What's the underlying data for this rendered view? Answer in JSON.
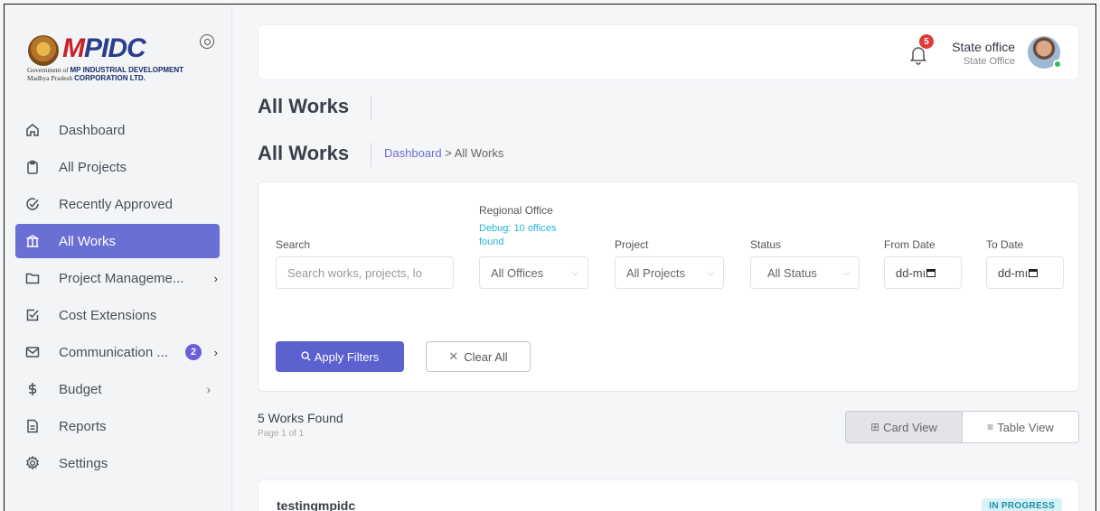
{
  "logo": {
    "brand_prefix": "M",
    "brand_text": "PIDC",
    "line1_left": "Government of",
    "line1_right": "MP INDUSTRIAL DEVELOPMENT",
    "line2_left": "Madhya Pradesh",
    "line2_right": "CORPORATION LTD."
  },
  "sidebar": {
    "items": [
      {
        "label": "Dashboard",
        "icon": "home-icon"
      },
      {
        "label": "All Projects",
        "icon": "clipboard-icon"
      },
      {
        "label": "Recently Approved",
        "icon": "check-circle-icon"
      },
      {
        "label": "All Works",
        "icon": "building-icon",
        "active": true
      },
      {
        "label": "Project Manageme...",
        "icon": "folder-icon",
        "chevron": "›"
      },
      {
        "label": "Cost Extensions",
        "icon": "check-square-icon"
      },
      {
        "label": "Communication ...",
        "icon": "mail-icon",
        "badge": "2",
        "chevron": "›"
      },
      {
        "label": "Budget",
        "icon": "dollar-icon",
        "chevron": "›"
      },
      {
        "label": "Reports",
        "icon": "document-icon"
      },
      {
        "label": "Settings",
        "icon": "gear-icon"
      }
    ]
  },
  "header": {
    "notification_count": "5",
    "user_name": "State office",
    "user_role": "State Office"
  },
  "page": {
    "title": "All Works",
    "subtitle": "All Works",
    "breadcrumb_link": "Dashboard",
    "breadcrumb_sep": ">",
    "breadcrumb_current": "All Works"
  },
  "filters": {
    "search_label": "Search",
    "search_placeholder": "Search works, projects, lo",
    "regional_label": "Regional Office",
    "debug_text": "Debug: 10 offices found",
    "regional_value": "All Offices",
    "project_label": "Project",
    "project_value": "All Projects",
    "status_label": "Status",
    "status_value": "All Status",
    "from_label": "From Date",
    "from_value": "dd-mı",
    "to_label": "To Date",
    "to_value": "dd-mı",
    "apply_label": "Apply Filters",
    "clear_label": "Clear All"
  },
  "results": {
    "count_text": "5 Works Found",
    "page_text": "Page 1 of 1",
    "card_view": "Card View",
    "table_view": "Table View"
  },
  "works": [
    {
      "name": "testingmpidc",
      "status": "IN PROGRESS"
    }
  ],
  "colors": {
    "accent": "#6a6fd4",
    "apply_button": "#5b61cf",
    "debug_text": "#27b5d6",
    "status_badge_bg": "#d7f2f6",
    "notification": "#e23b3b"
  }
}
